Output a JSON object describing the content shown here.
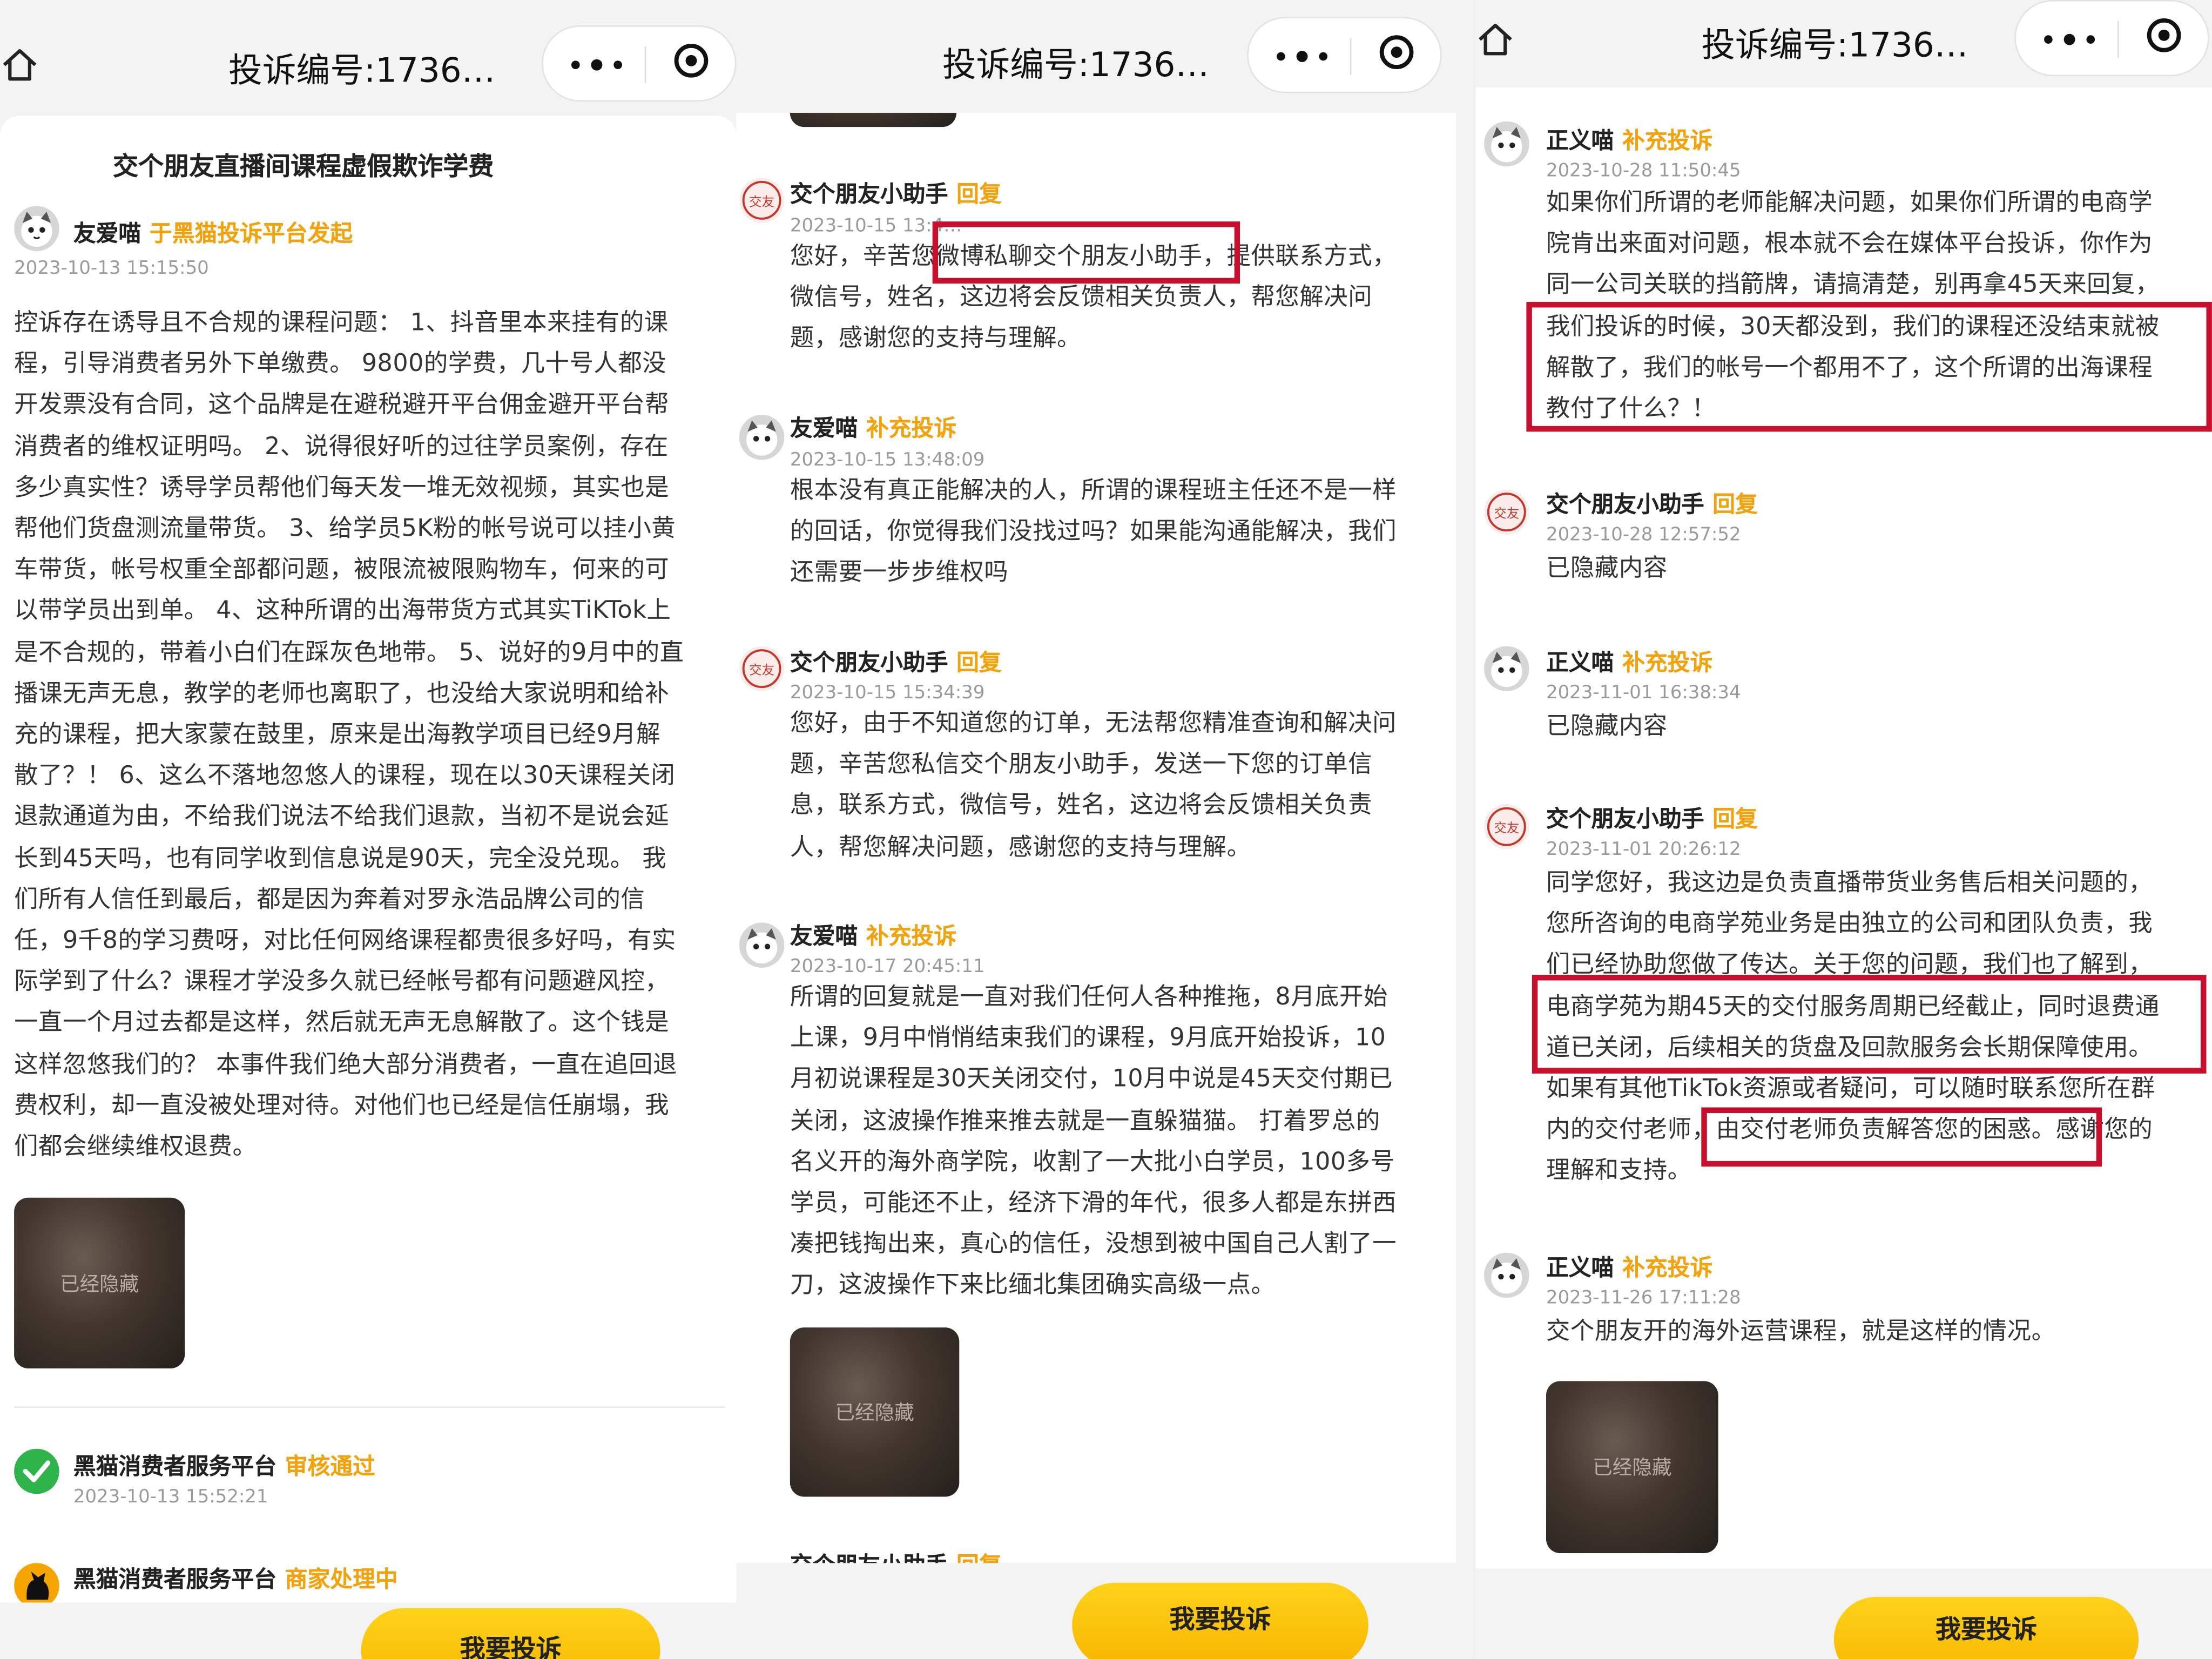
{
  "panel1": {
    "header_title": "投诉编号:1736…",
    "case_title": "交个朋友直播间课程虚假欺诈学费",
    "initiator": {
      "name": "友爱喵",
      "tag": "于黑猫投诉平台发起",
      "time": "2023-10-13 15:15:50"
    },
    "body_lines": [
      "控诉存在诱导且不合规的课程问题： 1、抖音里本来挂有的课",
      "程，引导消费者另外下单缴费。 9800的学费，几十号人都没",
      "开发票没有合同，这个品牌是在避税避开平台佣金避开平台帮",
      "消费者的维权证明吗。 2、说得很好听的过往学员案例，存在",
      "多少真实性？诱导学员帮他们每天发一堆无效视频，其实也是",
      "帮他们货盘测流量带货。 3、给学员5K粉的帐号说可以挂小黄",
      "车带货，帐号权重全部都问题，被限流被限购物车，何来的可",
      "以带学员出到单。 4、这种所谓的出海带货方式其实TiKTok上",
      "是不合规的，带着小白们在踩灰色地带。 5、说好的9月中的直",
      "播课无声无息，教学的老师也离职了，也没给大家说明和给补",
      "充的课程，把大家蒙在鼓里，原来是出海教学项目已经9月解",
      "散了？！ 6、这么不落地忽悠人的课程，现在以30天课程关闭",
      "退款通道为由，不给我们说法不给我们退款，当初不是说会延",
      "长到45天吗，也有同学收到信息说是90天，完全没兑现。 我",
      "们所有人信任到最后，都是因为奔着对罗永浩品牌公司的信",
      "任，9千8的学习费呀，对比任何网络课程都贵很多好吗，有实",
      "际学到了什么？课程才学没多久就已经帐号都有问题避风控，",
      "一直一个月过去都是这样，然后就无声无息解散了。这个钱是",
      "这样忽悠我们的？ 本事件我们绝大部分消费者，一直在追回退",
      "费权利，却一直没被处理对待。对他们也已经是信任崩塌，我",
      "们都会继续维权退费。"
    ],
    "hidden_image_label": "已经隐藏",
    "status1": {
      "name": "黑猫消费者服务平台",
      "tag": "审核通过",
      "time": "2023-10-13 15:52:21"
    },
    "status2": {
      "name": "黑猫消费者服务平台",
      "tag": "商家处理中"
    },
    "cta": "我要投诉"
  },
  "panel2": {
    "header_title": "投诉编号:1736…",
    "entries": [
      {
        "name": "交个朋友小助手",
        "tag": "回复",
        "time": "2023-10-15 13:4…",
        "lines": [
          "您好，辛苦您微博私聊交个朋友小助手，提供联系方式，",
          "微信号，姓名，这边将会反馈相关负责人，帮您解决问",
          "题，感谢您的支持与理解。"
        ]
      },
      {
        "name": "友爱喵",
        "tag": "补充投诉",
        "time": "2023-10-15 13:48:09",
        "lines": [
          "根本没有真正能解决的人，所谓的课程班主任还不是一样",
          "的回话，你觉得我们没找过吗？如果能沟通能解决，我们",
          "还需要一步步维权吗"
        ]
      },
      {
        "name": "交个朋友小助手",
        "tag": "回复",
        "time": "2023-10-15 15:34:39",
        "lines": [
          "您好，由于不知道您的订单，无法帮您精准查询和解决问",
          "题，辛苦您私信交个朋友小助手，发送一下您的订单信",
          "息，联系方式，微信号，姓名，这边将会反馈相关负责",
          "人，帮您解决问题，感谢您的支持与理解。"
        ]
      },
      {
        "name": "友爱喵",
        "tag": "补充投诉",
        "time": "2023-10-17 20:45:11",
        "lines": [
          "所谓的回复就是一直对我们任何人各种推拖，8月底开始",
          "上课，9月中悄悄结束我们的课程，9月底开始投诉，10",
          "月初说课程是30天关闭交付，10月中说是45天交付期已",
          "关闭，这波操作推来推去就是一直躲猫猫。 打着罗总的",
          "名义开的海外商学院，收割了一大批小白学员，100多号",
          "学员，可能还不止，经济下滑的年代，很多人都是东拼西",
          "凑把钱掏出来，真心的信任，没想到被中国自己人割了一",
          "刀，这波操作下来比缅北集团确实高级一点。"
        ]
      }
    ],
    "hidden_image_label": "已经隐藏",
    "next_name": "交个朋友小助手",
    "next_tag": "回复",
    "cta": "我要投诉"
  },
  "panel3": {
    "header_title": "投诉编号:1736…",
    "entries": [
      {
        "name": "正义喵",
        "tag": "补充投诉",
        "time": "2023-10-28 11:50:45",
        "lines": [
          "如果你们所谓的老师能解决问题，如果你们所谓的电商学",
          "院肯出来面对问题，根本就不会在媒体平台投诉，你作为",
          "同一公司关联的挡箭牌，请搞清楚，别再拿45天来回复，",
          "我们投诉的时候，30天都没到，我们的课程还没结束就被",
          "解散了，我们的帐号一个都用不了，这个所谓的出海课程",
          "教付了什么？！"
        ]
      },
      {
        "name": "交个朋友小助手",
        "tag": "回复",
        "time": "2023-10-28 12:57:52",
        "lines": [
          "已隐藏内容"
        ]
      },
      {
        "name": "正义喵",
        "tag": "补充投诉",
        "time": "2023-11-01 16:38:34",
        "lines": [
          "已隐藏内容"
        ]
      },
      {
        "name": "交个朋友小助手",
        "tag": "回复",
        "time": "2023-11-01 20:26:12",
        "lines": [
          "同学您好，我这边是负责直播带货业务售后相关问题的，",
          "您所咨询的电商学苑业务是由独立的公司和团队负责，我",
          "们已经协助您做了传达。关于您的问题，我们也了解到，",
          "电商学苑为期45天的交付服务周期已经截止，同时退费通",
          "道已关闭，后续相关的货盘及回款服务会长期保障使用。",
          "如果有其他TikTok资源或者疑问，可以随时联系您所在群",
          "内的交付老师，由交付老师负责解答您的困惑。感谢您的",
          "理解和支持。"
        ]
      },
      {
        "name": "正义喵",
        "tag": "补充投诉",
        "time": "2023-11-26 17:11:28",
        "lines": [
          "交个朋友开的海外运营课程，就是这样的情况。"
        ]
      }
    ],
    "hidden_image_label": "已经隐藏",
    "cta": "我要投诉"
  },
  "colors": {
    "accent": "#f2a20c",
    "highlight": "#c8102e",
    "button": "#f7b500"
  }
}
